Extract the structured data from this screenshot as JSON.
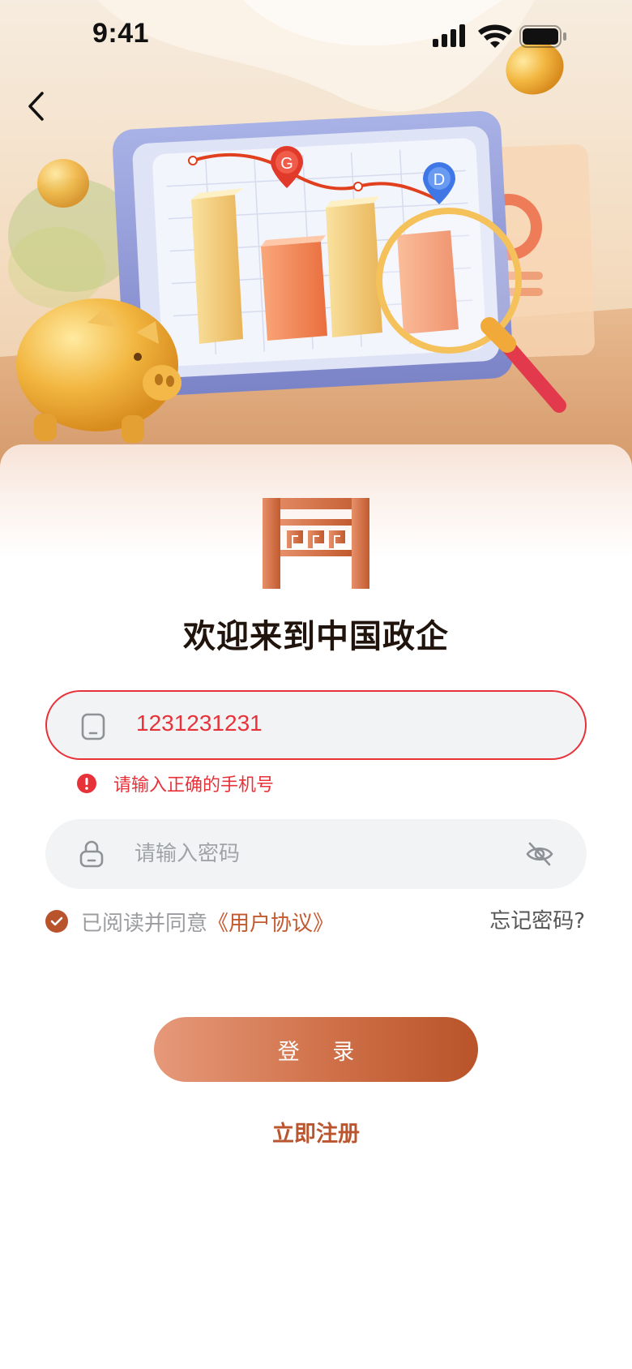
{
  "status_bar": {
    "time": "9:41"
  },
  "hero": {
    "marker_g": "G",
    "marker_d": "D"
  },
  "welcome_title": "欢迎来到中国政企",
  "phone": {
    "value": "1231231231",
    "error": "请输入正确的手机号"
  },
  "password": {
    "placeholder": "请输入密码"
  },
  "agreement": {
    "prefix": "已阅读并同意",
    "link": "《用户协议》",
    "checked": true
  },
  "forgot_password": "忘记密码?",
  "login_button": "登 录",
  "register_link": "立即注册",
  "colors": {
    "accent": "#c45a2f",
    "error": "#e8323a",
    "input_bg": "#f2f3f5"
  },
  "icons": {
    "back": "chevron-left-icon",
    "phone": "phone-icon",
    "lock": "lock-icon",
    "eye": "eye-off-icon",
    "error": "alert-icon",
    "check": "check-icon"
  }
}
